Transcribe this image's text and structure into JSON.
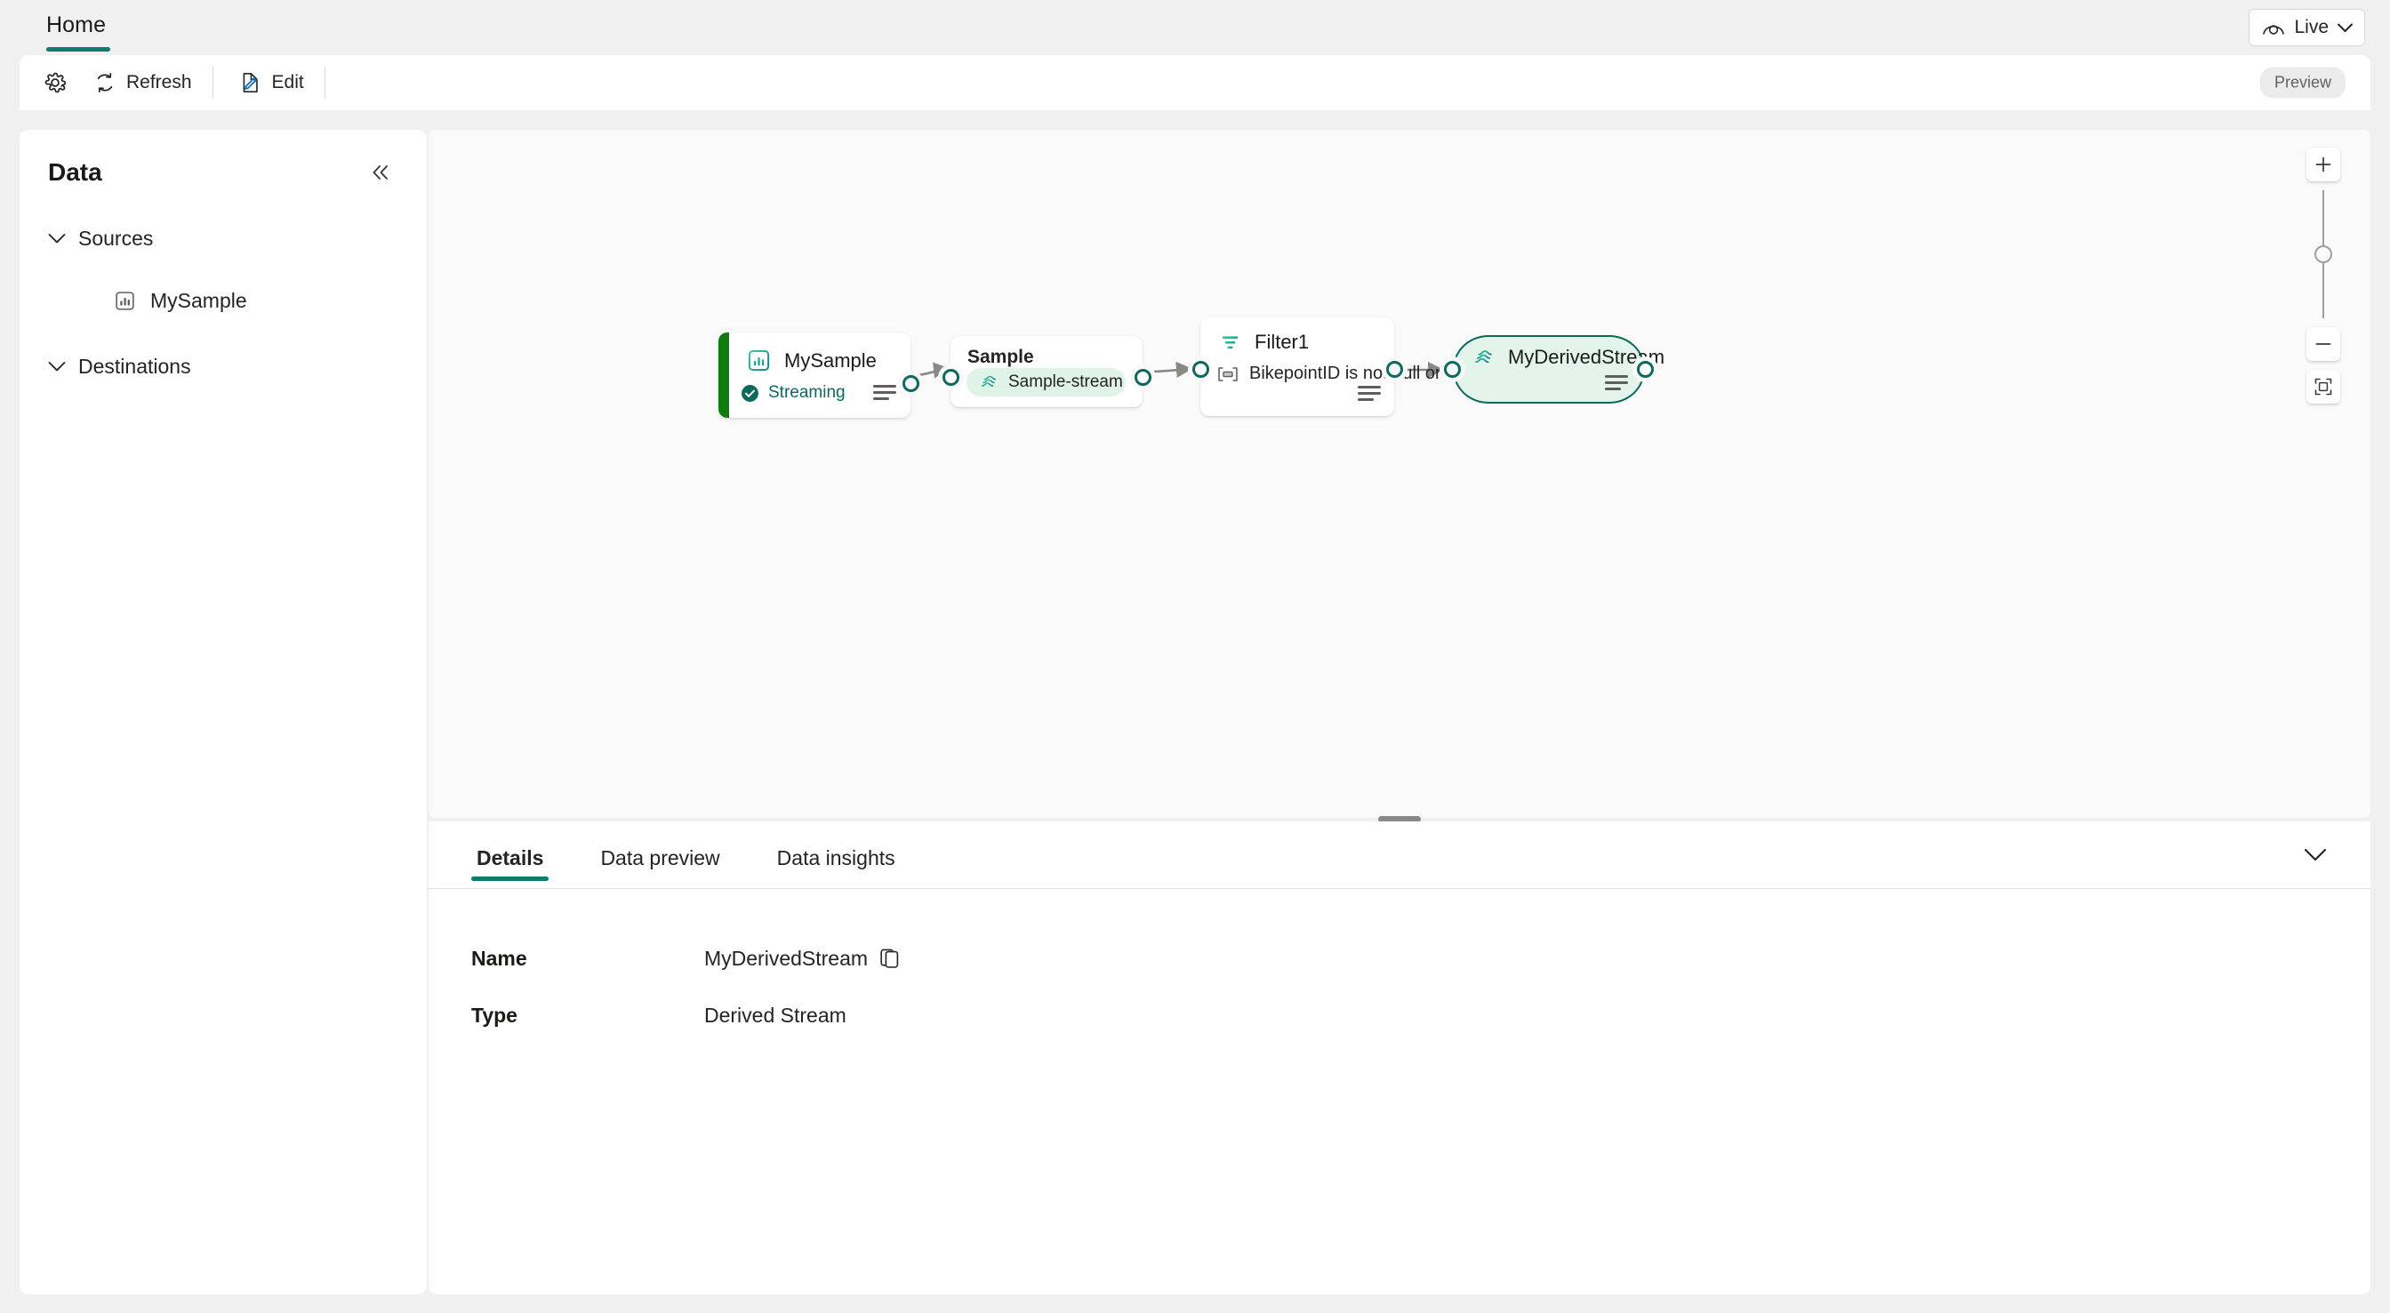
{
  "window": {
    "background_color": "#f0f0f0"
  },
  "tabstrip": {
    "home_tab_label": "Home",
    "accent_color": "#107a6e",
    "live_picker": {
      "label": "Live",
      "eye_icon": "eye-icon",
      "chevron_icon": "chevron-down-icon"
    }
  },
  "commandbar": {
    "settings_icon": "gear-icon",
    "refresh_label": "Refresh",
    "refresh_icon": "refresh-icon",
    "edit_label": "Edit",
    "edit_icon": "edit-pencil-icon",
    "preview_badge": "Preview"
  },
  "sidebar": {
    "title": "Data",
    "collapse_icon": "chevron-double-left-icon",
    "groups": [
      {
        "label": "Sources",
        "expanded": true,
        "chevron_icon": "chevron-down-icon",
        "items": [
          {
            "label": "MySample",
            "icon": "bar-chart-icon"
          }
        ]
      },
      {
        "label": "Destinations",
        "expanded": true,
        "chevron_icon": "chevron-down-icon",
        "items": []
      }
    ]
  },
  "canvas": {
    "background_color": "#fafafa",
    "nodes": {
      "mysample": {
        "title": "MySample",
        "icon": "bar-chart-icon",
        "status_label": "Streaming",
        "status_icon": "checkmark-circle-icon",
        "status_color": "#0b6a5b",
        "accent_color": "#107c10",
        "menu_icon": "hamburger-menu-icon"
      },
      "sample": {
        "title": "Sample",
        "stream_chip_label": "Sample-stream",
        "stream_chip_icon": "stream-icon",
        "stream_chip_color": "#dff3e6"
      },
      "filter": {
        "title": "Filter1",
        "icon": "filter-icon",
        "expression": "BikepointID is not null or e...",
        "expression_icon": "condition-box-icon",
        "menu_icon": "hamburger-menu-icon"
      },
      "derived": {
        "title": "MyDerivedStream",
        "icon": "stream-icon",
        "fill_color": "#e3f5ea",
        "border_color": "#0b6a5b",
        "menu_icon": "hamburger-menu-icon"
      }
    },
    "zoom_controls": {
      "zoom_in_icon": "plus-icon",
      "zoom_out_icon": "minus-icon",
      "fit_to_screen_icon": "fit-to-screen-icon",
      "slider_icon": "slider-thumb"
    }
  },
  "details": {
    "tabs": [
      {
        "label": "Details",
        "active": true
      },
      {
        "label": "Data preview",
        "active": false
      },
      {
        "label": "Data insights",
        "active": false
      }
    ],
    "collapse_icon": "chevron-down-icon",
    "rows": [
      {
        "label": "Name",
        "value": "MyDerivedStream",
        "copy_icon": "copy-icon"
      },
      {
        "label": "Type",
        "value": "Derived Stream",
        "copy_icon": null
      }
    ]
  }
}
